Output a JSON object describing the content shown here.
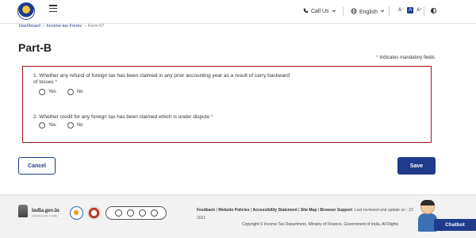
{
  "header": {
    "call_us": "Call Us",
    "language": "English",
    "font_small": "A⁻",
    "font_normal": "A",
    "font_large": "A⁺"
  },
  "breadcrumb": {
    "items": [
      "Dashboard",
      "Income-tax Forms",
      "Form 67"
    ],
    "separator": "›"
  },
  "page": {
    "title": "Part-B",
    "mandatory_note": "Indicates mandatory fields"
  },
  "questions": [
    {
      "text": "1. Whether any refund of foreign tax has been claimed in any prior accounting year as a result of carry backward of losses",
      "options": [
        "Yes",
        "No"
      ]
    },
    {
      "text": "2. Whether credit for any foreign tax has been claimed which is under dispute",
      "options": [
        "Yes",
        "No"
      ]
    }
  ],
  "buttons": {
    "cancel": "Cancel",
    "save": "Save"
  },
  "footer": {
    "indiagov_main": "india.gov.in",
    "indiagov_sub": "national portal of india",
    "link_feedback": "Feedback",
    "link_policies": "Website Policies",
    "link_accessibility": "Accessibility Statement",
    "link_sitemap": "Site Map",
    "link_browser": "Browser Support",
    "last_reviewed": "Last reviewed and update on : 23",
    "year": "2021",
    "copyright": "Copyright © Income Tax Department, Ministry of Finance, Government of India. All Rights"
  },
  "chatbot": {
    "label": "Chatbot"
  },
  "colors": {
    "brand": "#1f3b8c",
    "error_border": "#a31515",
    "required": "#c0392b"
  },
  "icons": {
    "phone": "phone-icon",
    "globe": "globe-icon",
    "contrast": "contrast-icon",
    "menu": "hamburger-icon"
  }
}
